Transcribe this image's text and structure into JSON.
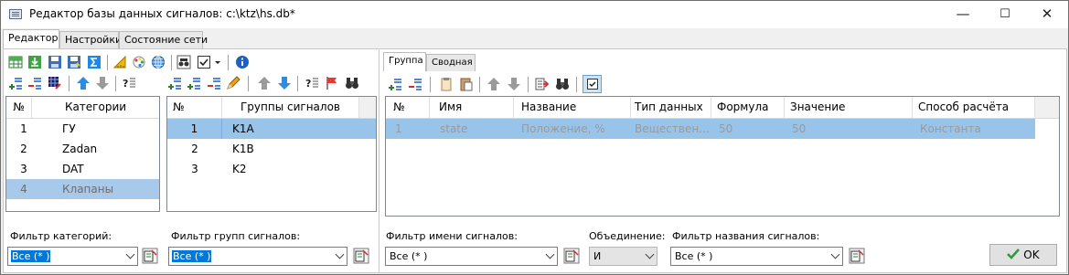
{
  "window": {
    "title": "Редактор базы данных сигналов: c:\\ktz\\hs.db*",
    "minimize": "—",
    "maximize": "☐",
    "close": "✕"
  },
  "main_tabs": [
    "Редактор",
    "Настройки",
    "Состояние сети"
  ],
  "categories": {
    "headers": [
      "№",
      "Категории"
    ],
    "rows": [
      {
        "num": "1",
        "name": "ГУ"
      },
      {
        "num": "2",
        "name": "Zadan"
      },
      {
        "num": "3",
        "name": "DAT"
      },
      {
        "num": "4",
        "name": "Клапаны"
      }
    ],
    "filter_label": "Фильтр категорий:",
    "filter_value": "Все (* )"
  },
  "groups": {
    "headers": [
      "№",
      "Группы сигналов"
    ],
    "rows": [
      {
        "num": "1",
        "name": "K1A"
      },
      {
        "num": "2",
        "name": "K1B"
      },
      {
        "num": "3",
        "name": "K2"
      }
    ],
    "filter_label": "Фильтр групп сигналов:",
    "filter_value": "Все (* )"
  },
  "signals": {
    "tabs": [
      "Группа",
      "Сводная"
    ],
    "headers": [
      "№",
      "Имя",
      "Название",
      "Тип данных",
      "Формула",
      "Значение",
      "Способ расчёта"
    ],
    "rows": [
      {
        "num": "1",
        "name": "state",
        "title": "Положение, %",
        "type": "Веществен...",
        "formula": "50",
        "value": "50",
        "method": "Константа"
      }
    ]
  },
  "filters": {
    "name_label": "Фильтр имени сигналов:",
    "name_value": "Все (* )",
    "union_label": "Объединение:",
    "union_value": "И",
    "title_label": "Фильтр названия сигналов:",
    "title_value": "Все (* )"
  },
  "ok_label": "OK",
  "colors": {
    "selection": "#99c4ea",
    "selection_dim": "#a8c9ea",
    "accent": "#0078d7"
  }
}
